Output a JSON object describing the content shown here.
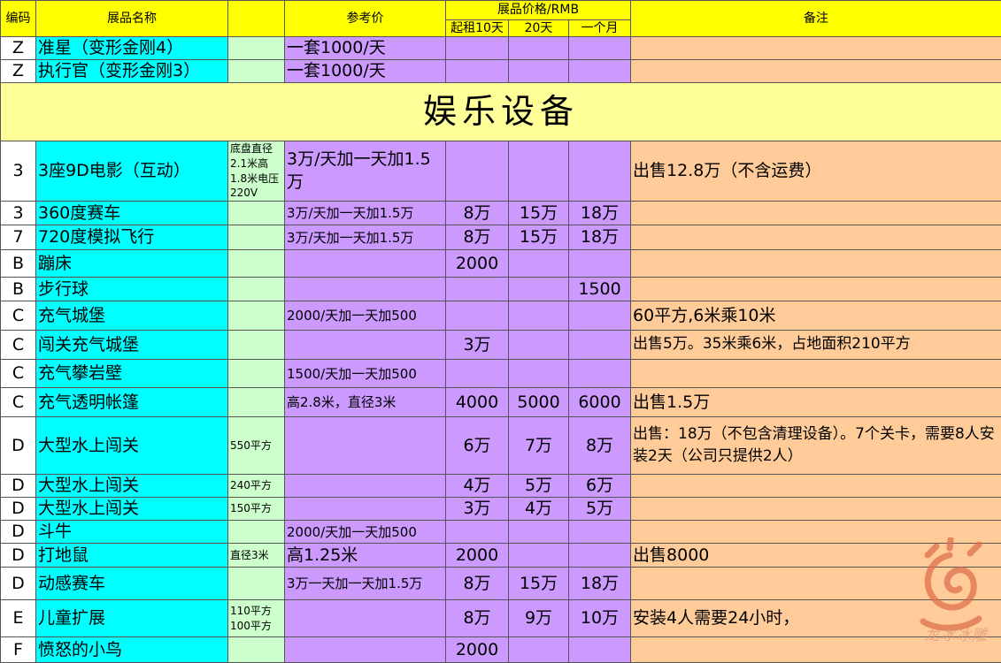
{
  "header": {
    "code": "编码",
    "name": "展品名称",
    "ref": "参考价",
    "price_group": "展品价格/RMB",
    "p10": "起租10天",
    "p20": "20天",
    "pm": "一个月",
    "note": "备注"
  },
  "rows_top": [
    {
      "code": "Z",
      "name": "准星（变形金刚4）",
      "spec": "",
      "ref": "一套1000/天",
      "p10": "",
      "p20": "",
      "pm": "",
      "note": ""
    },
    {
      "code": "Z",
      "name": "执行官（变形金刚3）",
      "spec": "",
      "ref": "一套1000/天",
      "p10": "",
      "p20": "",
      "pm": "",
      "note": ""
    }
  ],
  "section_title": "娱乐设备",
  "rows": [
    {
      "code": "3",
      "name": "3座9D电影（互动）",
      "spec": "底盘直径2.1米高1.8米电压220V",
      "ref": "3万/天加一天加1.5万",
      "p10": "",
      "p20": "",
      "pm": "",
      "note": "出售12.8万（不含运费）"
    },
    {
      "code": "3",
      "name": "360度赛车",
      "spec": "",
      "ref": "3万/天加一天加1.5万",
      "p10": "8万",
      "p20": "15万",
      "pm": "18万",
      "note": ""
    },
    {
      "code": "7",
      "name": "720度模拟飞行",
      "spec": "",
      "ref": "3万/天加一天加1.5万",
      "p10": "8万",
      "p20": "15万",
      "pm": "18万",
      "note": ""
    },
    {
      "code": "B",
      "name": "蹦床",
      "spec": "",
      "ref": "",
      "p10": "2000",
      "p20": "",
      "pm": "",
      "note": ""
    },
    {
      "code": "B",
      "name": "步行球",
      "spec": "",
      "ref": "",
      "p10": "",
      "p20": "",
      "pm": "1500",
      "note": ""
    },
    {
      "code": "C",
      "name": "充气城堡",
      "spec": "",
      "ref": "2000/天加一天加500",
      "p10": "",
      "p20": "",
      "pm": "",
      "note": "60平方,6米乘10米"
    },
    {
      "code": "C",
      "name": "闯关充气城堡",
      "spec": "",
      "ref": "",
      "p10": "3万",
      "p20": "",
      "pm": "",
      "note": "出售5万。35米乘6米，占地面积210平方"
    },
    {
      "code": "C",
      "name": "充气攀岩壁",
      "spec": "",
      "ref": "1500/天加一天加500",
      "p10": "",
      "p20": "",
      "pm": "",
      "note": ""
    },
    {
      "code": "C",
      "name": "充气透明帐篷",
      "spec": "",
      "ref": "高2.8米，直径3米",
      "p10": "4000",
      "p20": "5000",
      "pm": "6000",
      "note": "出售1.5万"
    },
    {
      "code": "D",
      "name": "大型水上闯关",
      "spec": "550平方",
      "ref": "",
      "p10": "6万",
      "p20": "7万",
      "pm": "8万",
      "note": "出售：18万（不包含清理设备）。7个关卡，需要8人安装2天（公司只提供2人）"
    },
    {
      "code": "D",
      "name": "大型水上闯关",
      "spec": "240平方",
      "ref": "",
      "p10": "4万",
      "p20": "5万",
      "pm": "6万",
      "note": ""
    },
    {
      "code": "D",
      "name": "大型水上闯关",
      "spec": "150平方",
      "ref": "",
      "p10": "3万",
      "p20": "4万",
      "pm": "5万",
      "note": ""
    },
    {
      "code": "D",
      "name": "斗牛",
      "spec": "",
      "ref": "2000/天加一天加500",
      "p10": "",
      "p20": "",
      "pm": "",
      "note": ""
    },
    {
      "code": "D",
      "name": "打地鼠",
      "spec": "直径3米",
      "ref": "高1.25米",
      "p10": "2000",
      "p20": "",
      "pm": "",
      "note": "出售8000"
    },
    {
      "code": "D",
      "name": "动感赛车",
      "spec": "",
      "ref": "3万一天加一天加1.5万",
      "p10": "8万",
      "p20": "15万",
      "pm": "18万",
      "note": ""
    },
    {
      "code": "E",
      "name": "儿童扩展",
      "spec": "110平方 100平方",
      "ref": "",
      "p10": "8万",
      "p20": "9万",
      "pm": "10万",
      "note": "安装4人需要24小时，"
    },
    {
      "code": "F",
      "name": "愤怒的小鸟",
      "spec": "",
      "ref": "",
      "p10": "2000",
      "p20": "",
      "pm": "",
      "note": ""
    }
  ],
  "watermark": "龙冰冰雕"
}
